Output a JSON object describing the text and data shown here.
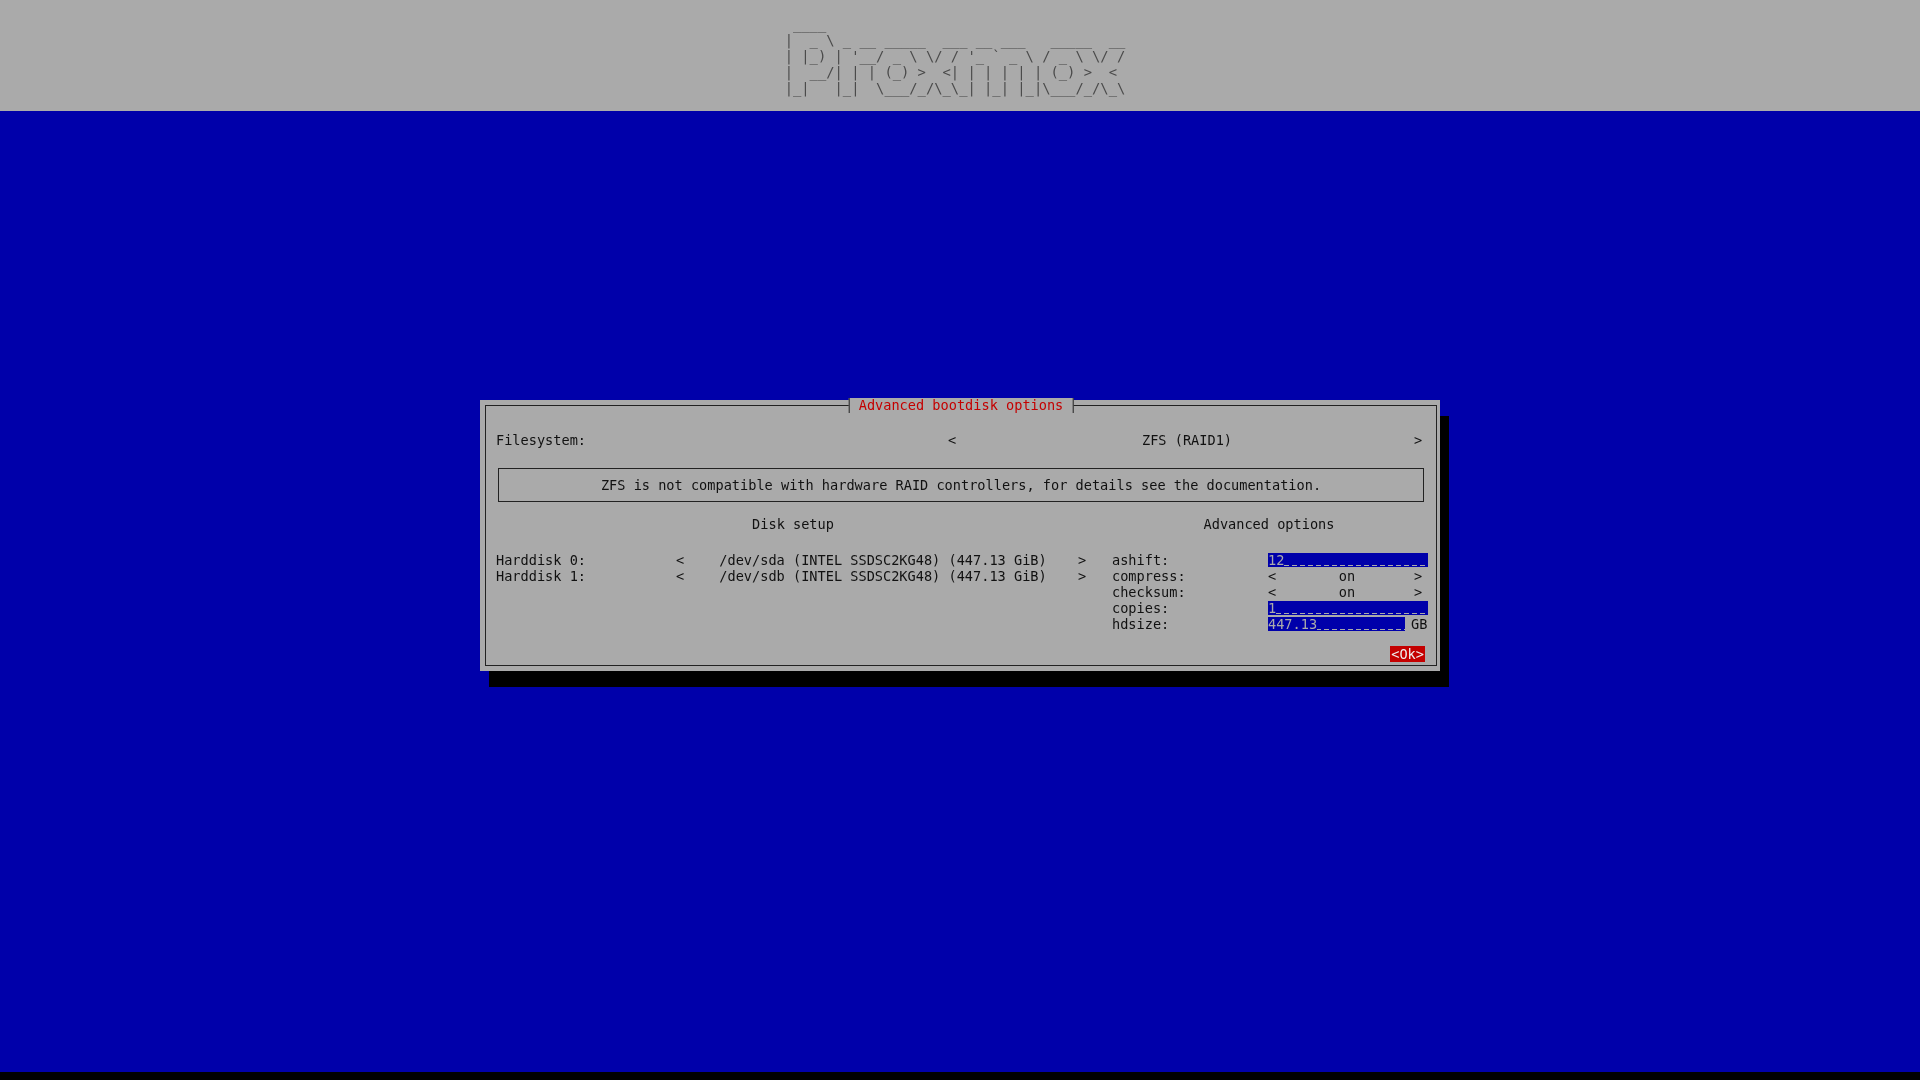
{
  "header": {
    "logo_lines": [
      " ____",
      "|  _ \\ _ __ _____  ___ __ ___   _____  __",
      "| |_) | '__/ _ \\ \\/ / '_ ` _ \\ / _ \\ \\/ /",
      "|  __/| | | (_) >  <| | | | | | (_) >  <",
      "|_|   |_|  \\___/_/\\_\\_| |_| |_|\\___/_/\\_\\"
    ]
  },
  "dialog": {
    "title": "Advanced bootdisk options",
    "filesystem": {
      "label": "Filesystem:",
      "prev": "<",
      "value": "ZFS (RAID1)",
      "next": ">"
    },
    "notice": "ZFS is not compatible with hardware RAID controllers, for details see the documentation.",
    "disk_setup": {
      "heading": "Disk setup",
      "disks": [
        {
          "label": "Harddisk 0:",
          "prev": "<",
          "value": "/dev/sda (INTEL SSDSC2KG48) (447.13 GiB)",
          "next": ">"
        },
        {
          "label": "Harddisk 1:",
          "prev": "<",
          "value": "/dev/sdb (INTEL SSDSC2KG48) (447.13 GiB)",
          "next": ">"
        }
      ]
    },
    "advanced": {
      "heading": "Advanced options",
      "options": [
        {
          "kind": "input",
          "label": "ashift:",
          "value": "12"
        },
        {
          "kind": "select",
          "label": "compress:",
          "prev": "<",
          "value": "on",
          "next": ">"
        },
        {
          "kind": "select",
          "label": "checksum:",
          "prev": "<",
          "value": "on",
          "next": ">"
        },
        {
          "kind": "input",
          "label": "copies:",
          "value": "1"
        },
        {
          "kind": "input",
          "label": "hdsize:",
          "value": "447.13",
          "unit": "GB"
        }
      ]
    },
    "ok_button": "<Ok>"
  }
}
